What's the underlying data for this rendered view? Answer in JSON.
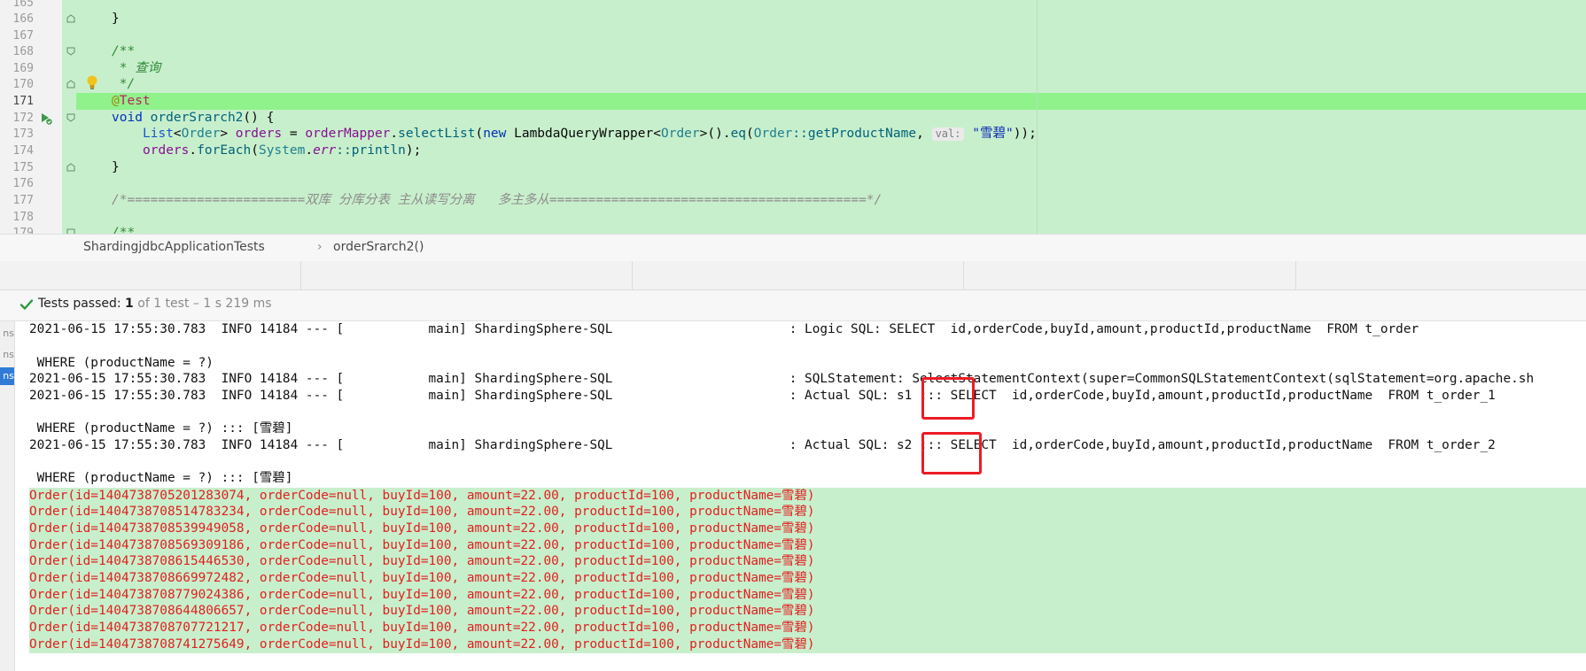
{
  "editor": {
    "line_numbers": [
      "165",
      "166",
      "167",
      "168",
      "169",
      "170",
      "171",
      "172",
      "173",
      "174",
      "175",
      "176",
      "177",
      "178",
      "179"
    ],
    "current_line": "171",
    "code": {
      "l166": "}",
      "l168": "/**",
      "l169": " * 查询",
      "l170": " */",
      "l171_at": "@",
      "l171_ann": "Test",
      "l172_kw": "void ",
      "l172_fn": "orderSrarch2",
      "l172_rest": "() {",
      "l173_list": "List",
      "l173_lt": "<",
      "l173_order": "Order",
      "l173_gt": "> ",
      "l173_orders": "orders",
      "l173_eq": " = ",
      "l173_mapper": "orderMapper",
      "l173_dot": ".",
      "l173_select": "selectList",
      "l173_paren": "(",
      "l173_new": "new ",
      "l173_lqw": "LambdaQueryWrapper",
      "l173_lt2": "<",
      "l173_order2": "Order",
      "l173_gt2": ">().",
      "l173_eqm": "eq",
      "l173_p2": "(",
      "l173_order3": "Order",
      "l173_ref": "::getProductName",
      "l173_comma": ", ",
      "l173_hint": "val:",
      "l173_str": "\"雪碧\"",
      "l173_end": "));",
      "l174_orders": "orders",
      "l174_dot": ".",
      "l174_fe": "forEach",
      "l174_p": "(",
      "l174_sys": "System",
      "l174_dot2": ".",
      "l174_err": "err",
      "l174_println": "::println",
      "l174_end": ");",
      "l175": "}",
      "l177": "/*=======================双库 分库分表 主从读写分离   多主多从=========================================*/",
      "l179": "/**"
    }
  },
  "breadcrumb": {
    "class_name": "ShardingjdbcApplicationTests",
    "separator": "›",
    "method_name": "orderSrarch2()"
  },
  "test_status": {
    "label": "Tests passed: ",
    "count": "1",
    "detail": " of 1 test – 1 s 219 ms"
  },
  "console": {
    "strip_items": [
      "ns",
      "ns",
      "ns"
    ],
    "lines": [
      "2021-06-15 17:55:30.783  INFO 14184 --- [           main] ShardingSphere-SQL                       : Logic SQL: SELECT  id,orderCode,buyId,amount,productId,productName  FROM t_order",
      "",
      " WHERE (productName = ?)",
      "2021-06-15 17:55:30.783  INFO 14184 --- [           main] ShardingSphere-SQL                       : SQLStatement: SelectStatementContext(super=CommonSQLStatementContext(sqlStatement=org.apache.sh",
      "2021-06-15 17:55:30.783  INFO 14184 --- [           main] ShardingSphere-SQL                       : Actual SQL: s1 ::: SELECT  id,orderCode,buyId,amount,productId,productName  FROM t_order_1",
      "",
      " WHERE (productName = ?) ::: [雪碧]",
      "2021-06-15 17:55:30.783  INFO 14184 --- [           main] ShardingSphere-SQL                       : Actual SQL: s2 ::: SELECT  id,orderCode,buyId,amount,productId,productName  FROM t_order_2",
      "",
      " WHERE (productName = ?) ::: [雪碧]"
    ],
    "orders": [
      "Order(id=1404738705201283074, orderCode=null, buyId=100, amount=22.00, productId=100, productName=雪碧)",
      "Order(id=1404738708514783234, orderCode=null, buyId=100, amount=22.00, productId=100, productName=雪碧)",
      "Order(id=1404738708539949058, orderCode=null, buyId=100, amount=22.00, productId=100, productName=雪碧)",
      "Order(id=1404738708569309186, orderCode=null, buyId=100, amount=22.00, productId=100, productName=雪碧)",
      "Order(id=1404738708615446530, orderCode=null, buyId=100, amount=22.00, productId=100, productName=雪碧)",
      "Order(id=1404738708669972482, orderCode=null, buyId=100, amount=22.00, productId=100, productName=雪碧)",
      "Order(id=1404738708779024386, orderCode=null, buyId=100, amount=22.00, productId=100, productName=雪碧)",
      "Order(id=1404738708644806657, orderCode=null, buyId=100, amount=22.00, productId=100, productName=雪碧)",
      "Order(id=1404738708707721217, orderCode=null, buyId=100, amount=22.00, productId=100, productName=雪碧)",
      "Order(id=1404738708741275649, orderCode=null, buyId=100, amount=22.00, productId=100, productName=雪碧)"
    ]
  },
  "colors": {
    "editor_bg": "#c8efcc",
    "current_line": "#8ff28b",
    "error_text": "#e21f1f",
    "highlight_box": "#ec1c24",
    "pass_check": "#2e9a3e"
  }
}
